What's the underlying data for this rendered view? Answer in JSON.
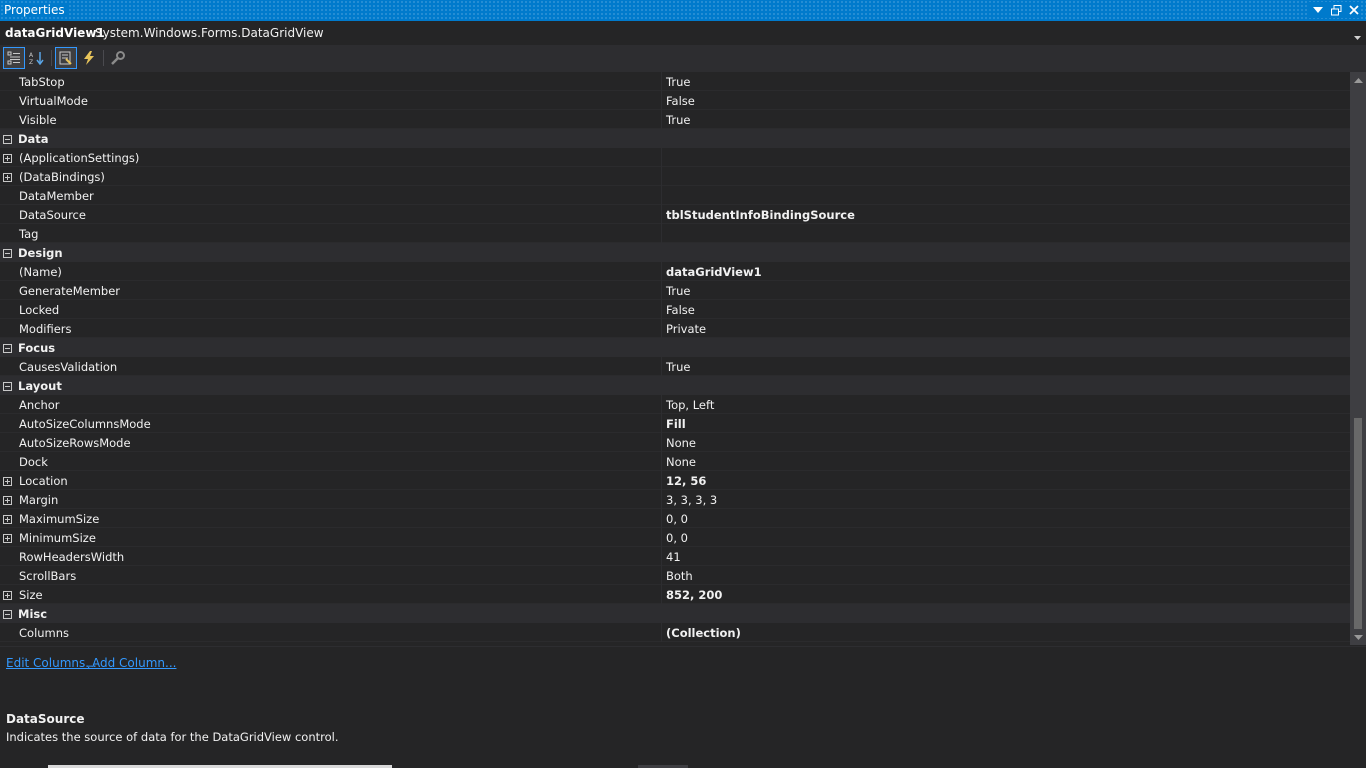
{
  "window": {
    "title": "Properties"
  },
  "object": {
    "name": "dataGridView1",
    "type": "System.Windows.Forms.DataGridView"
  },
  "toolbar": {
    "buttons": [
      "categorized-icon",
      "alphabetical-icon",
      "properties-icon",
      "events-icon",
      "property-pages-icon"
    ]
  },
  "rows": [
    {
      "kind": "prop",
      "name": "TabStop",
      "value": "True",
      "bold": false,
      "expandable": false
    },
    {
      "kind": "prop",
      "name": "VirtualMode",
      "value": "False",
      "bold": false,
      "expandable": false
    },
    {
      "kind": "prop",
      "name": "Visible",
      "value": "True",
      "bold": false,
      "expandable": false
    },
    {
      "kind": "cat",
      "name": "Data"
    },
    {
      "kind": "prop",
      "name": "(ApplicationSettings)",
      "value": "",
      "bold": false,
      "expandable": true
    },
    {
      "kind": "prop",
      "name": "(DataBindings)",
      "value": "",
      "bold": false,
      "expandable": true
    },
    {
      "kind": "prop",
      "name": "DataMember",
      "value": "",
      "bold": false,
      "expandable": false
    },
    {
      "kind": "prop",
      "name": "DataSource",
      "value": "tblStudentInfoBindingSource",
      "bold": true,
      "expandable": false
    },
    {
      "kind": "prop",
      "name": "Tag",
      "value": "",
      "bold": false,
      "expandable": false
    },
    {
      "kind": "cat",
      "name": "Design"
    },
    {
      "kind": "prop",
      "name": "(Name)",
      "value": "dataGridView1",
      "bold": true,
      "expandable": false
    },
    {
      "kind": "prop",
      "name": "GenerateMember",
      "value": "True",
      "bold": false,
      "expandable": false
    },
    {
      "kind": "prop",
      "name": "Locked",
      "value": "False",
      "bold": false,
      "expandable": false
    },
    {
      "kind": "prop",
      "name": "Modifiers",
      "value": "Private",
      "bold": false,
      "expandable": false
    },
    {
      "kind": "cat",
      "name": "Focus"
    },
    {
      "kind": "prop",
      "name": "CausesValidation",
      "value": "True",
      "bold": false,
      "expandable": false
    },
    {
      "kind": "cat",
      "name": "Layout"
    },
    {
      "kind": "prop",
      "name": "Anchor",
      "value": "Top, Left",
      "bold": false,
      "expandable": false
    },
    {
      "kind": "prop",
      "name": "AutoSizeColumnsMode",
      "value": "Fill",
      "bold": true,
      "expandable": false
    },
    {
      "kind": "prop",
      "name": "AutoSizeRowsMode",
      "value": "None",
      "bold": false,
      "expandable": false
    },
    {
      "kind": "prop",
      "name": "Dock",
      "value": "None",
      "bold": false,
      "expandable": false
    },
    {
      "kind": "prop",
      "name": "Location",
      "value": "12, 56",
      "bold": true,
      "expandable": true
    },
    {
      "kind": "prop",
      "name": "Margin",
      "value": "3, 3, 3, 3",
      "bold": false,
      "expandable": true
    },
    {
      "kind": "prop",
      "name": "MaximumSize",
      "value": "0, 0",
      "bold": false,
      "expandable": true
    },
    {
      "kind": "prop",
      "name": "MinimumSize",
      "value": "0, 0",
      "bold": false,
      "expandable": true
    },
    {
      "kind": "prop",
      "name": "RowHeadersWidth",
      "value": "41",
      "bold": false,
      "expandable": false
    },
    {
      "kind": "prop",
      "name": "ScrollBars",
      "value": "Both",
      "bold": false,
      "expandable": false
    },
    {
      "kind": "prop",
      "name": "Size",
      "value": "852, 200",
      "bold": true,
      "expandable": true
    },
    {
      "kind": "cat",
      "name": "Misc"
    },
    {
      "kind": "prop",
      "name": "Columns",
      "value": "(Collection)",
      "bold": true,
      "expandable": false
    }
  ],
  "commands": {
    "edit_columns": "Edit Columns...",
    "separator": ",",
    "add_column": "Add Column..."
  },
  "description": {
    "title": "DataSource",
    "text": "Indicates the source of data for the DataGridView control."
  },
  "colors": {
    "accent": "#007acc",
    "background": "#252526",
    "category": "#2d2d30",
    "link": "#3399ff"
  }
}
